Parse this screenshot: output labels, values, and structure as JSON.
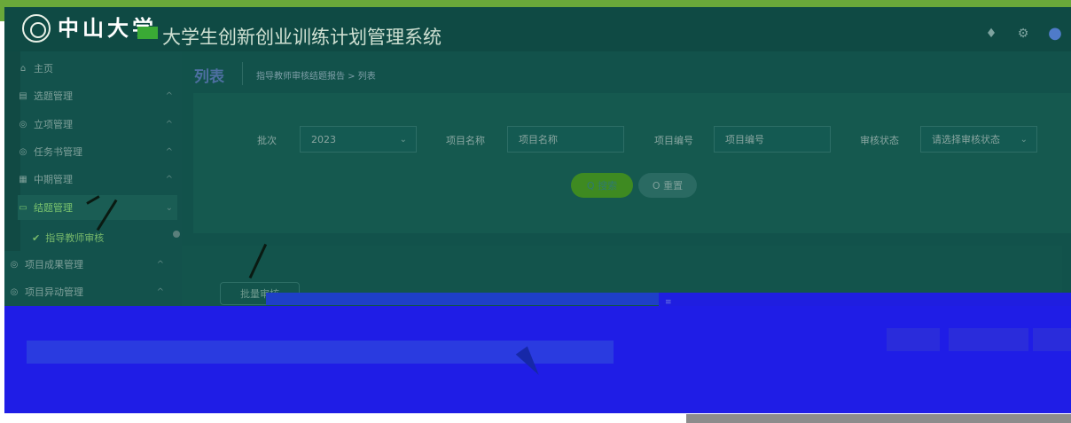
{
  "header": {
    "logo_text": "中山大学",
    "system_title": "大学生创新创业训练计划管理系统",
    "icons": [
      "bell-icon",
      "gear-icon",
      "user-icon"
    ]
  },
  "sidebar": {
    "items": [
      {
        "label": "主页",
        "icon": "home-icon",
        "expandable": false
      },
      {
        "label": "选题管理",
        "icon": "list-icon",
        "expandable": true
      },
      {
        "label": "立项管理",
        "icon": "shield-icon",
        "expandable": true
      },
      {
        "label": "任务书管理",
        "icon": "shield-icon",
        "expandable": true
      },
      {
        "label": "中期管理",
        "icon": "grid-icon",
        "expandable": true
      },
      {
        "label": "结题管理",
        "icon": "monitor-icon",
        "expandable": true,
        "active": true
      },
      {
        "label": "项目成果管理",
        "icon": "shield-icon",
        "expandable": true
      },
      {
        "label": "项目异动管理",
        "icon": "shield-icon",
        "expandable": true
      }
    ],
    "active_sub_item": "指导教师审核"
  },
  "breadcrumb": {
    "title": "列表",
    "path": "指导教师审核结题报告 > 列表"
  },
  "search": {
    "batch_label": "批次",
    "batch_value": "2023",
    "project_name_label": "项目名称",
    "project_name_placeholder": "项目名称",
    "project_no_label": "项目编号",
    "project_no_placeholder": "项目编号",
    "status_label": "审核状态",
    "status_placeholder": "请选择审核状态",
    "search_button": "Q 搜索",
    "reset_button": "O 重置"
  },
  "table": {
    "batch_review_button": "批量审核"
  },
  "colors": {
    "header_bg": "#0f4a44",
    "sidebar_bg": "#13524c",
    "overlay_blue": "#1f1de6",
    "top_green": "#6aa83a"
  }
}
